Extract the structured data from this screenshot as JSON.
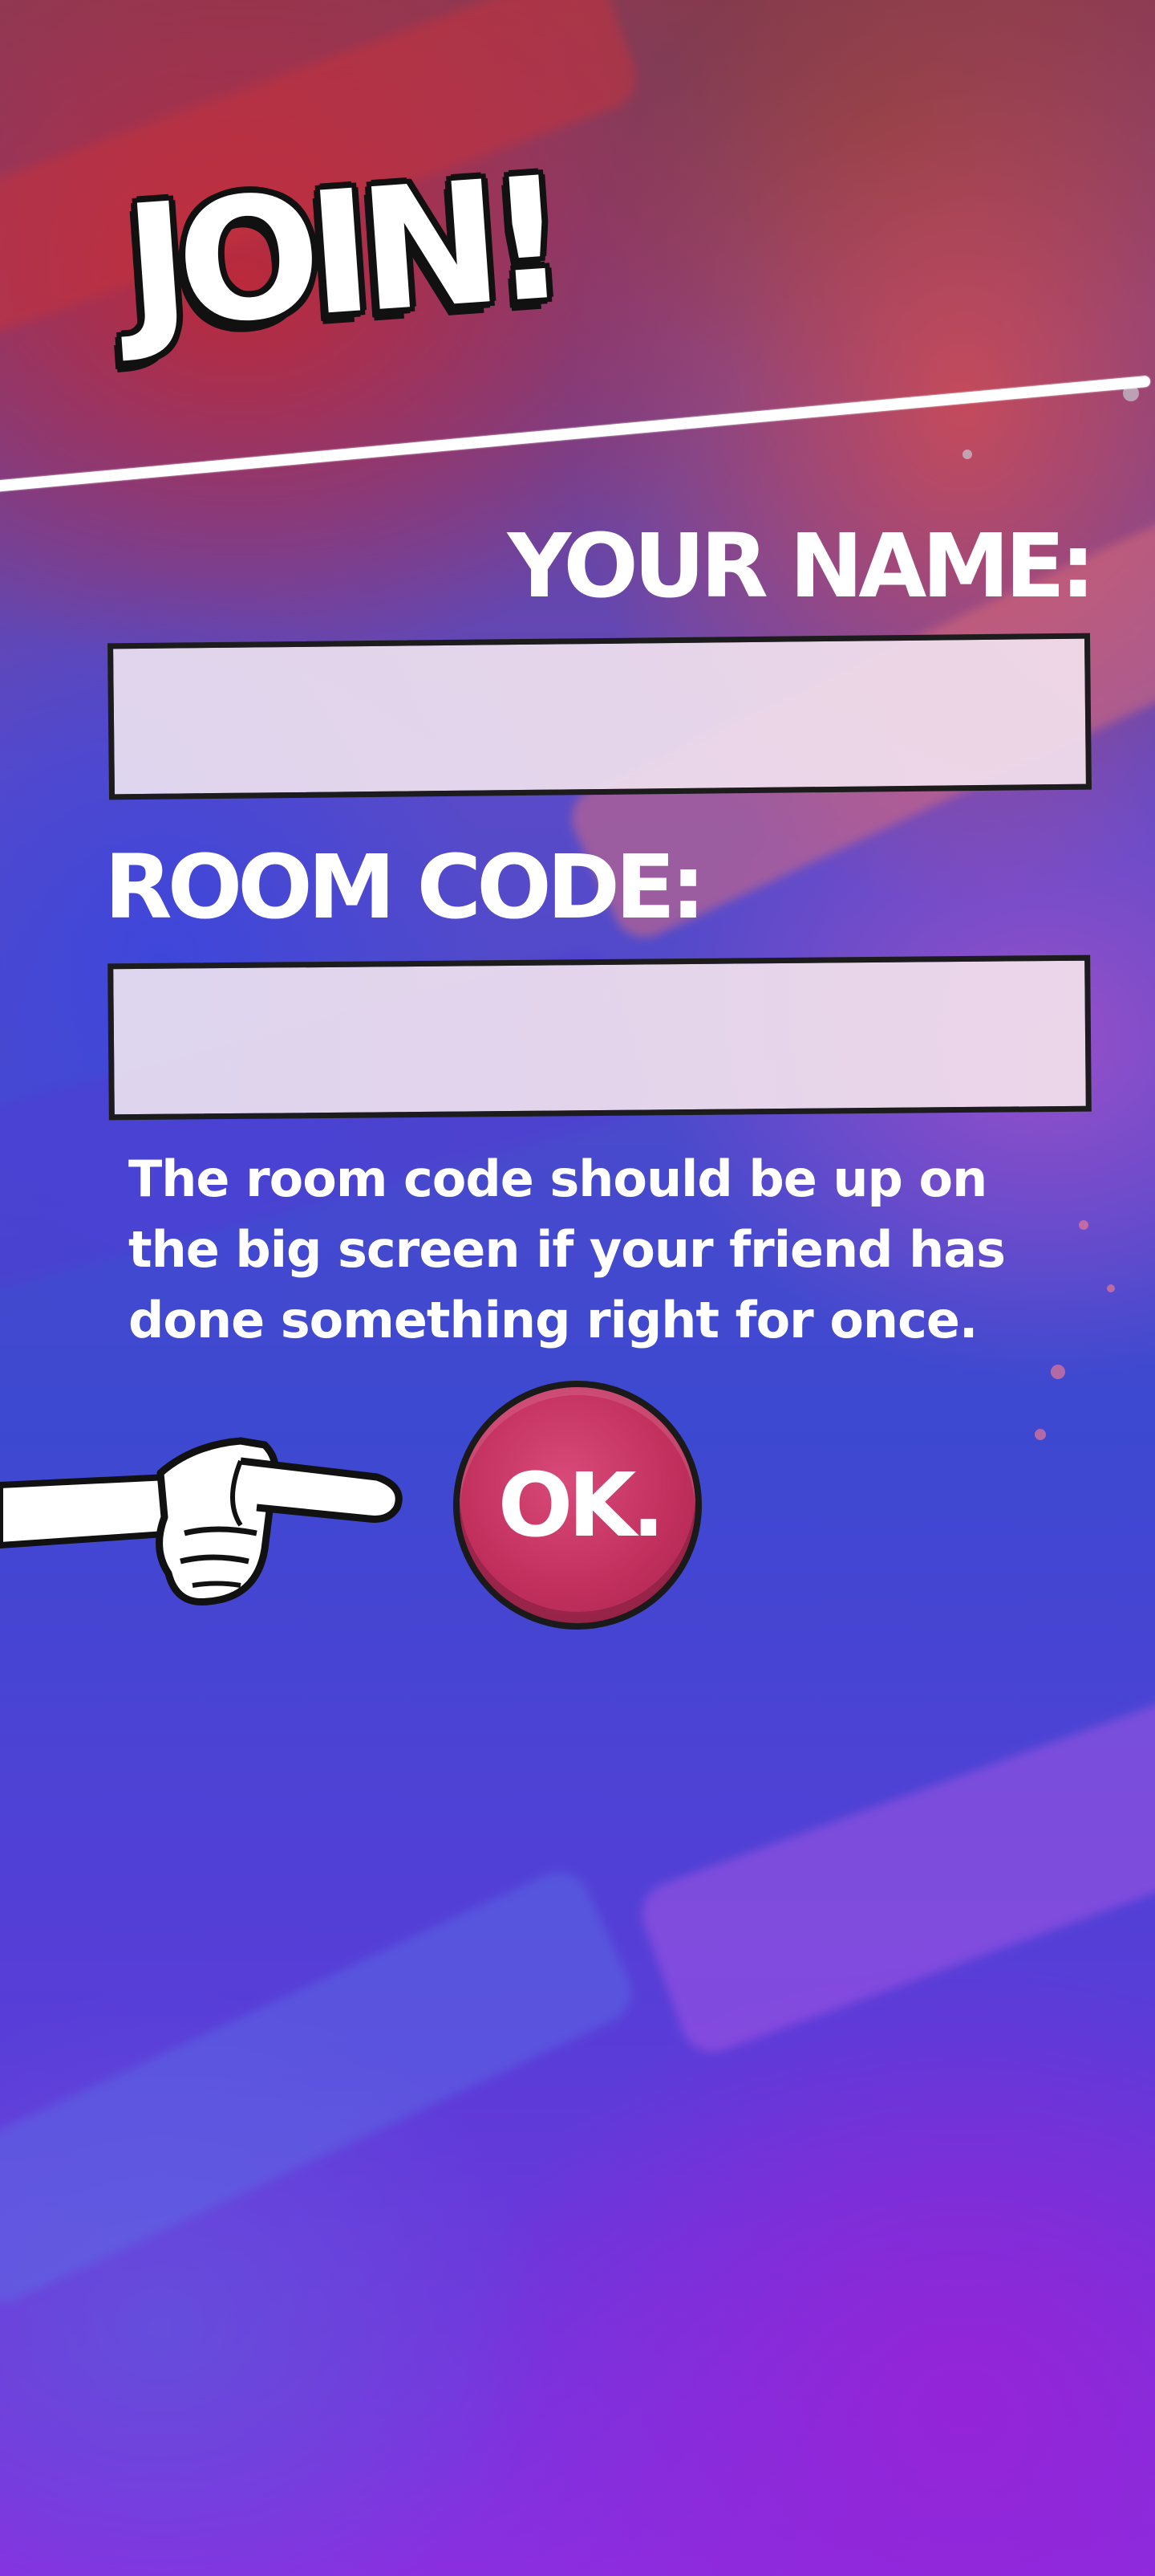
{
  "title": "JOIN!",
  "name_field": {
    "label": "YOUR NAME:",
    "value": "",
    "placeholder": ""
  },
  "room_field": {
    "label": "ROOM CODE:",
    "value": "",
    "placeholder": ""
  },
  "hint_text": "The room code should be up on the big screen if your friend has done something right for once.",
  "ok_button": {
    "label": "OK."
  },
  "colors": {
    "ok_button": "#c2305e",
    "text": "#ffffff",
    "outline": "#1a1a1a"
  },
  "icons": {
    "pointer": "pointing-hand-icon"
  }
}
